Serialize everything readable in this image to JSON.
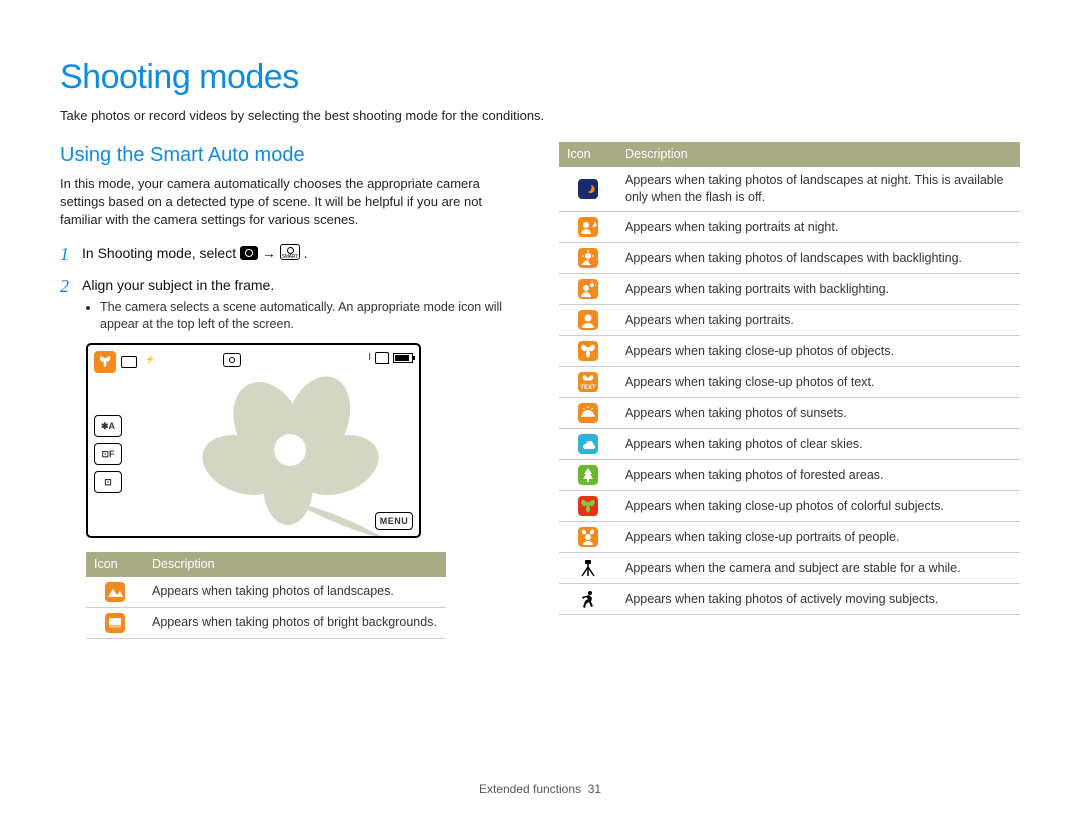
{
  "page_title": "Shooting modes",
  "intro": "Take photos or record videos by selecting the best shooting mode for the conditions.",
  "section_title": "Using the Smart Auto mode",
  "section_para": "In this mode, your camera automatically chooses the appropriate camera settings based on a detected type of scene. It will be helpful if you are not familiar with the camera settings for various scenes.",
  "steps": {
    "s1": {
      "num": "1",
      "text_a": "In Shooting mode, select ",
      "arrow": " → ",
      "text_b": "."
    },
    "s2": {
      "num": "2",
      "text": "Align your subject in the frame.",
      "bullet": "The camera selects a scene automatically. An appropriate mode icon will appear at the top left of the screen."
    }
  },
  "screen_ui": {
    "left_buttons": [
      "✱A",
      "⊡F",
      "⊡"
    ],
    "menu_label": "MENU",
    "topright_text": "I"
  },
  "table_headers": {
    "icon": "Icon",
    "desc": "Description"
  },
  "left_table": [
    {
      "desc": "Appears when taking photos of landscapes."
    },
    {
      "desc": "Appears when taking photos of bright backgrounds."
    }
  ],
  "right_table": [
    {
      "desc": "Appears when taking photos of landscapes at night. This is available only when the flash is off."
    },
    {
      "desc": "Appears when taking portraits at night."
    },
    {
      "desc": "Appears when taking photos of landscapes with backlighting."
    },
    {
      "desc": "Appears when taking portraits with backlighting."
    },
    {
      "desc": "Appears when taking portraits."
    },
    {
      "desc": "Appears when taking close-up photos of objects."
    },
    {
      "desc": "Appears when taking close-up photos of text."
    },
    {
      "desc": "Appears when taking photos of sunsets."
    },
    {
      "desc": "Appears when taking photos of clear skies."
    },
    {
      "desc": "Appears when taking photos of forested areas."
    },
    {
      "desc": "Appears when taking close-up photos of colorful subjects."
    },
    {
      "desc": "Appears when taking close-up portraits of people."
    },
    {
      "desc": "Appears when the camera and subject are stable for a while."
    },
    {
      "desc": "Appears when taking photos of actively moving subjects."
    }
  ],
  "footer": {
    "section": "Extended functions",
    "page": "31"
  }
}
